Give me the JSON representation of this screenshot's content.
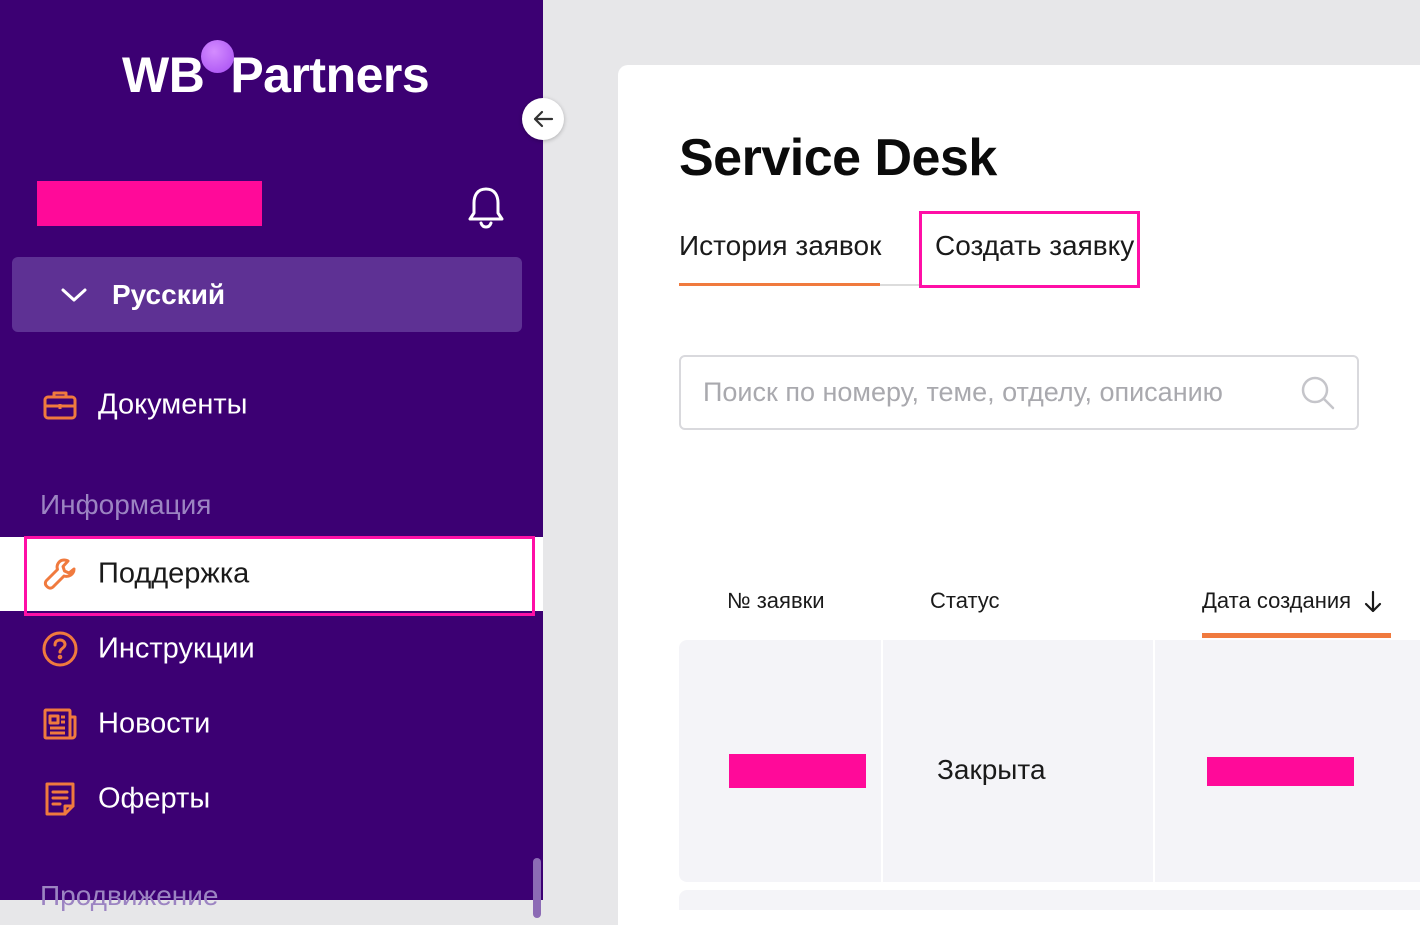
{
  "brand": {
    "logo_left": "WB",
    "logo_right": "Partners"
  },
  "sidebar": {
    "language": "Русский",
    "items": [
      {
        "label": "Документы",
        "icon": "briefcase-icon"
      },
      {
        "label": "Поддержка",
        "icon": "wrench-icon",
        "active": true
      },
      {
        "label": "Инструкции",
        "icon": "question-circle-icon"
      },
      {
        "label": "Новости",
        "icon": "newspaper-icon"
      },
      {
        "label": "Оферты",
        "icon": "document-icon"
      }
    ],
    "section_info": "Информация",
    "section_promo": "Продвижение"
  },
  "main": {
    "title": "Service Desk",
    "tabs": {
      "history": "История заявок",
      "create": "Создать заявку"
    },
    "search": {
      "placeholder": "Поиск по номеру, теме, отделу, описанию"
    },
    "table": {
      "columns": {
        "number": "№ заявки",
        "status": "Статус",
        "created": "Дата создания"
      },
      "rows": [
        {
          "status": "Закрыта"
        }
      ]
    }
  },
  "colors": {
    "sidebar_bg": "#3c0073",
    "accent_orange": "#f07a3e",
    "highlight_pink": "#ff0fa6",
    "redaction": "#ff0a99"
  }
}
